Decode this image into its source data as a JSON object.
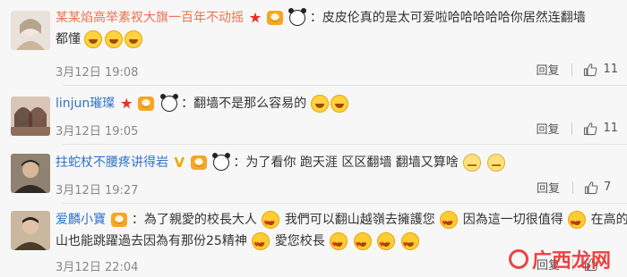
{
  "comments": [
    {
      "username": "某某焰高举素衩大旗一百年不动摇",
      "text_line1": "：皮皮伦真的是太可爱啦哈哈哈哈哈你居然连翻墙",
      "text_line2": "都懂",
      "date": "3月12日 19:08",
      "reply_label": "回复",
      "likes": "11",
      "avatar_colors": [
        "#d8d0c8",
        "#bfa98f"
      ]
    },
    {
      "username": "linjun璀璨",
      "text_line1": "：翻墙不是那么容易的",
      "date": "3月12日 19:05",
      "reply_label": "回复",
      "likes": "11",
      "avatar_colors": [
        "#c9b2a2",
        "#6b4a3a"
      ]
    },
    {
      "username": "拄蛇杖不腰疼讲得岩",
      "text_line1": "：为了看你 跑天涯 区区翻墙 翻墙又算啥",
      "date": "3月12日 19:27",
      "reply_label": "回复",
      "likes": "7",
      "avatar_colors": [
        "#7a6a55",
        "#3a2f25"
      ]
    },
    {
      "username": "爱麟小寶",
      "text_line1": "：為了親愛的校長大人",
      "text_line1b": "我們可以翻山越嶺去擁護您",
      "text_line1c": "因為這一切很值得",
      "text_line1d": "在高的",
      "text_line2": "山也能跳躍過去因為有那份25精神",
      "text_line2b": "愛您校長",
      "date": "3月12日 22:04",
      "reply_label": "回复",
      "likes": "",
      "avatar_colors": [
        "#b8a58c",
        "#4a3b2d"
      ]
    }
  ],
  "icons": {
    "like": "thumb-up-icon",
    "star_badge": "red-star-icon",
    "level_badge": "member-level-icon",
    "panda": "panda-icon",
    "laugh": "laughing-emoji-icon",
    "heart_eyes": "heart-eyes-emoji-icon",
    "shy": "shy-emoji-icon",
    "verified": "v-verified-icon"
  },
  "watermark": {
    "text": "广西龙网"
  },
  "colors": {
    "username_orange": "#eb7350",
    "username_blue": "#2e73c9",
    "star_red": "#e8302a",
    "watermark_red": "#ed2f2f"
  }
}
